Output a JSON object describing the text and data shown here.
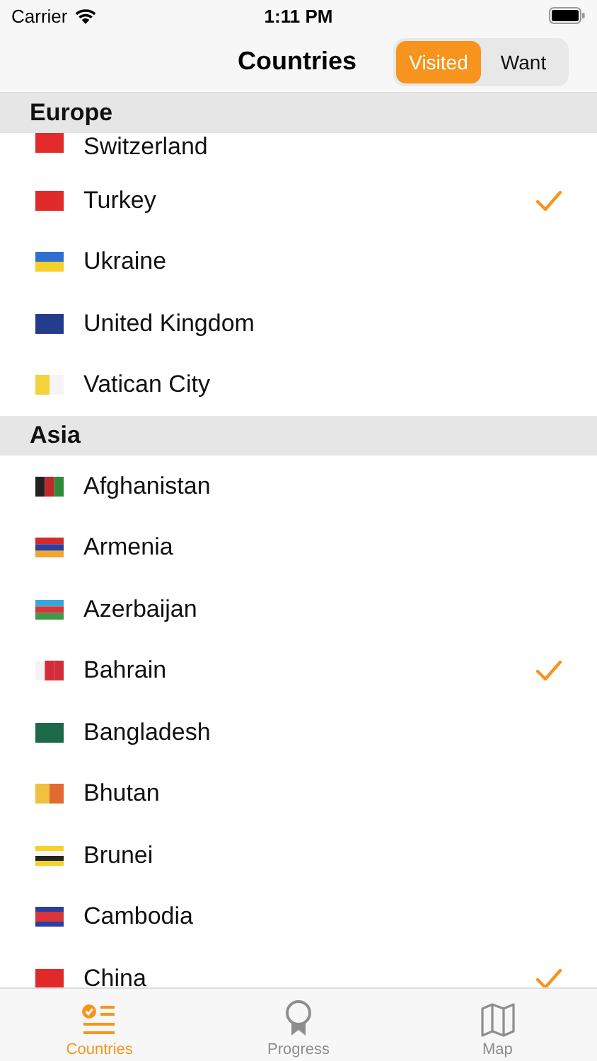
{
  "status_bar": {
    "carrier": "Carrier",
    "time": "1:11 PM"
  },
  "nav": {
    "title": "Countries",
    "segments": [
      {
        "label": "Visited",
        "selected": true
      },
      {
        "label": "Want",
        "selected": false
      }
    ]
  },
  "sections": [
    {
      "title": "Europe",
      "countries": [
        {
          "name": "Switzerland",
          "checked": false
        },
        {
          "name": "Turkey",
          "checked": true
        },
        {
          "name": "Ukraine",
          "checked": false
        },
        {
          "name": "United Kingdom",
          "checked": false
        },
        {
          "name": "Vatican City",
          "checked": false
        }
      ]
    },
    {
      "title": "Asia",
      "countries": [
        {
          "name": "Afghanistan",
          "checked": false
        },
        {
          "name": "Armenia",
          "checked": false
        },
        {
          "name": "Azerbaijan",
          "checked": false
        },
        {
          "name": "Bahrain",
          "checked": true
        },
        {
          "name": "Bangladesh",
          "checked": false
        },
        {
          "name": "Bhutan",
          "checked": false
        },
        {
          "name": "Brunei",
          "checked": false
        },
        {
          "name": "Cambodia",
          "checked": false
        },
        {
          "name": "China",
          "checked": true
        }
      ]
    }
  ],
  "tab_bar": [
    {
      "label": "Countries",
      "selected": true
    },
    {
      "label": "Progress",
      "selected": false
    },
    {
      "label": "Map",
      "selected": false
    }
  ]
}
